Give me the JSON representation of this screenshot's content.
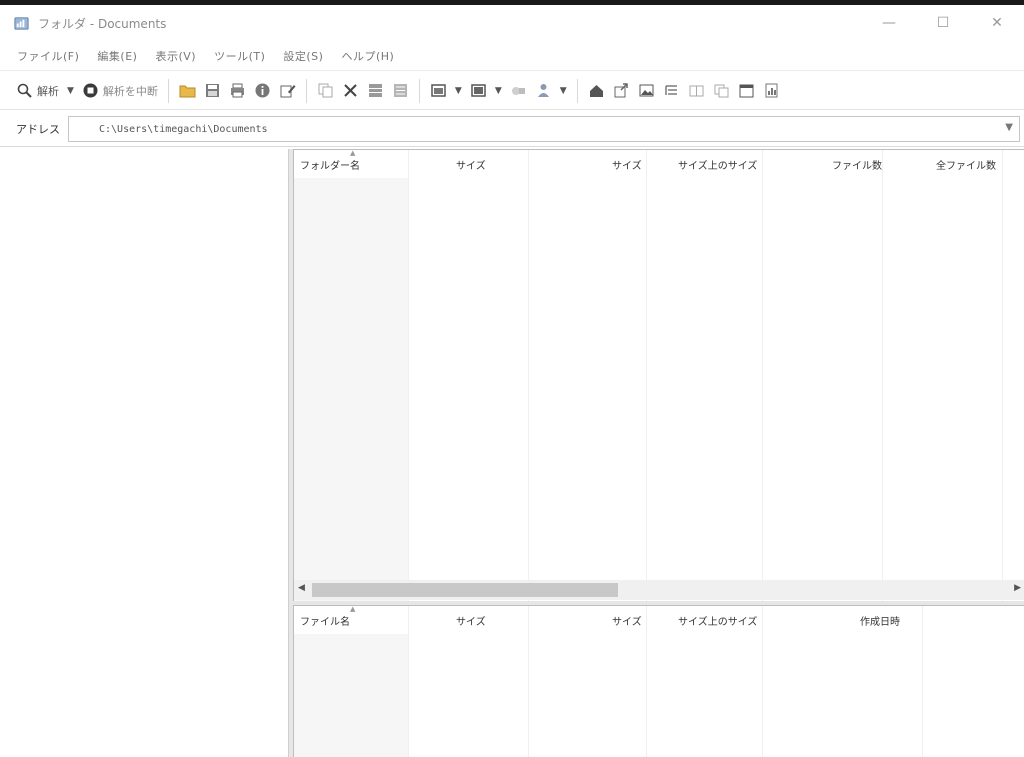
{
  "window": {
    "title": "フォルダ - Documents",
    "controls": {
      "minimize": "—",
      "maximize": "☐",
      "close": "✕"
    }
  },
  "menu": [
    "ファイル(F)",
    "編集(E)",
    "表示(V)",
    "ツール(T)",
    "設定(S)",
    "ヘルプ(H)"
  ],
  "toolbar": {
    "scan_label": "解析",
    "stop_label": "解析を中断"
  },
  "address": {
    "label": "アドレス",
    "path": "C:\\Users\\timegachi\\Documents"
  },
  "folder_table": {
    "columns": [
      "フォルダー名",
      "サイズ",
      "サイズ",
      "サイズ上のサイズ",
      "ファイル数",
      "全ファイル数"
    ],
    "rows": []
  },
  "file_table": {
    "columns": [
      "ファイル名",
      "サイズ",
      "サイズ",
      "サイズ上のサイズ",
      "作成日時"
    ],
    "rows": []
  },
  "colors": {
    "accent": "#1f6fbf",
    "folder": "#e8b84a",
    "pane_border": "#bdbdbd",
    "scroll_thumb": "#c8c8c8"
  }
}
